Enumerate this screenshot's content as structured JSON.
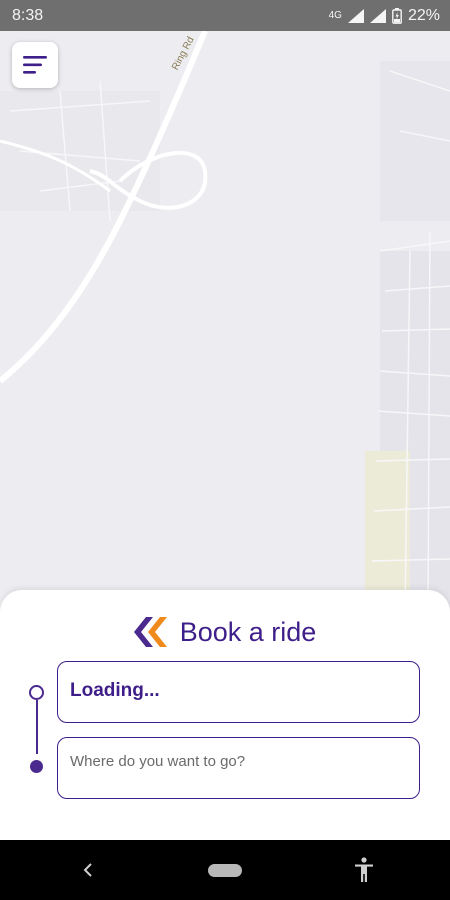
{
  "status_bar": {
    "time": "8:38",
    "network": "4G",
    "battery": "22%"
  },
  "map": {
    "road_label": "Ring Rd"
  },
  "menu": {
    "icon": "menu-icon"
  },
  "booking": {
    "title": "Book a ride",
    "pickup_value": "Loading...",
    "destination_placeholder": "Where do you want to go?",
    "accent_color": "#3e1f8a",
    "logo_color_primary": "#4b2a8f",
    "logo_color_secondary": "#f08a1c"
  },
  "nav_bar": {
    "back_icon": "back-icon",
    "home_icon": "home-pill-icon",
    "accessibility_icon": "accessibility-icon"
  }
}
